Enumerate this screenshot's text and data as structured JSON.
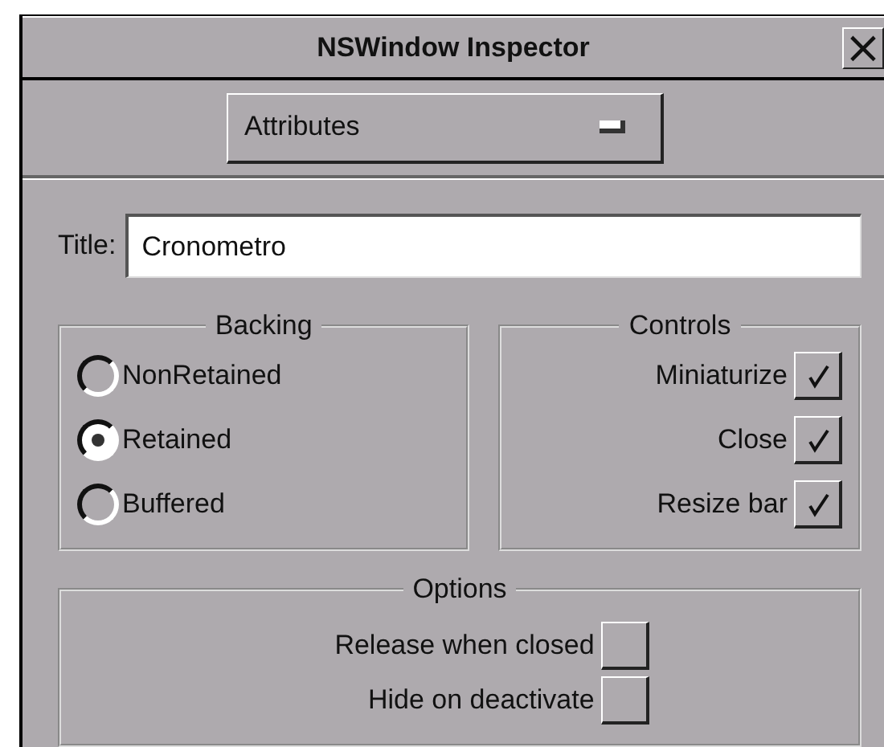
{
  "window": {
    "title": "NSWindow Inspector",
    "close": "×"
  },
  "popup": {
    "value": "Attributes"
  },
  "title_field": {
    "label": "Title:",
    "value": "Cronometro"
  },
  "backing": {
    "title": "Backing",
    "options": [
      {
        "label": "NonRetained",
        "selected": false
      },
      {
        "label": "Retained",
        "selected": true
      },
      {
        "label": "Buffered",
        "selected": false
      }
    ]
  },
  "controls": {
    "title": "Controls",
    "items": [
      {
        "label": "Miniaturize",
        "checked": true
      },
      {
        "label": "Close",
        "checked": true
      },
      {
        "label": "Resize bar",
        "checked": true
      }
    ]
  },
  "options": {
    "title": "Options",
    "items": [
      {
        "label": "Release when closed",
        "checked": false
      },
      {
        "label": "Hide on deactivate",
        "checked": false
      }
    ]
  }
}
